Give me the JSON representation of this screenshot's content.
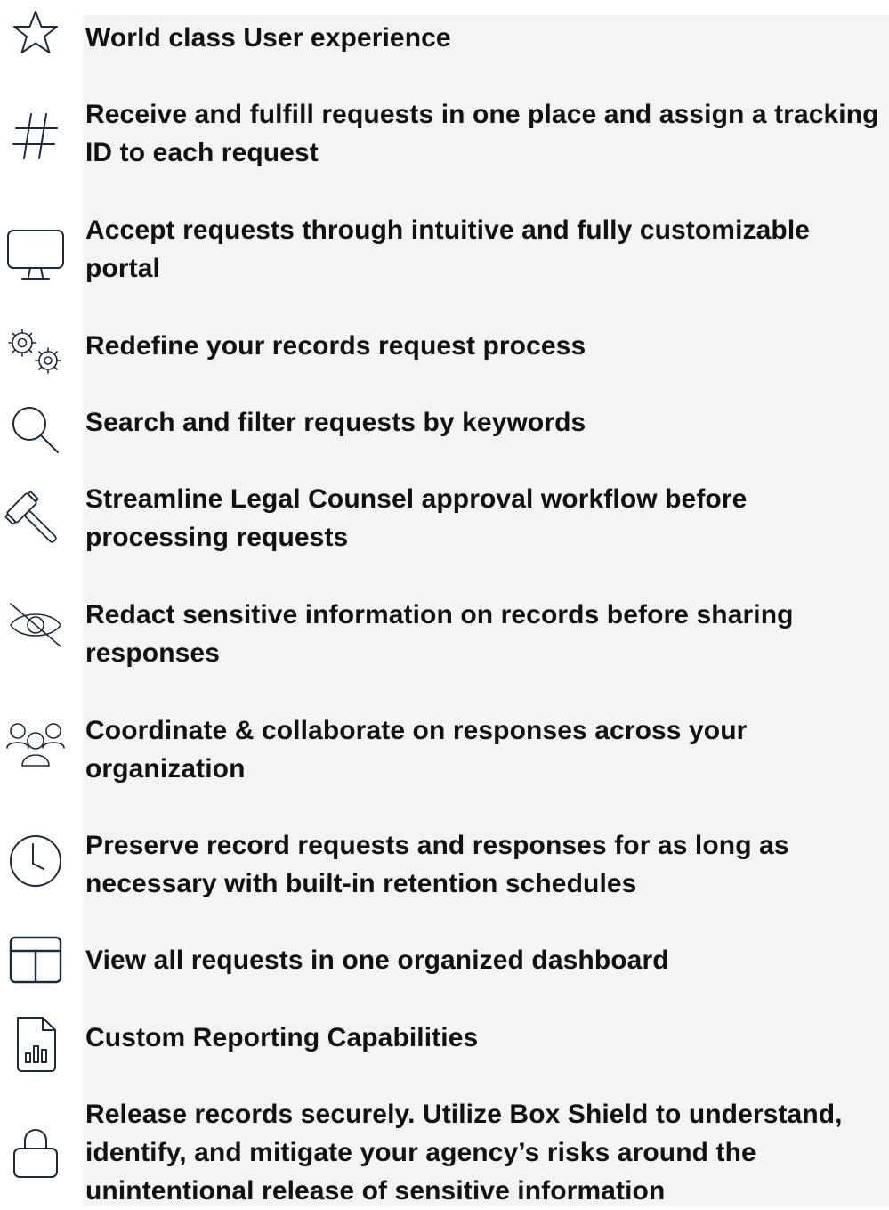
{
  "features": [
    {
      "icon": "star-icon",
      "text": "World class User experience"
    },
    {
      "icon": "hashtag-icon",
      "text": "Receive and fulfill requests in one place and assign a tracking ID to each request"
    },
    {
      "icon": "monitor-icon",
      "text": "Accept requests through intuitive and fully customizable portal"
    },
    {
      "icon": "gears-icon",
      "text": "Redefine your records request process"
    },
    {
      "icon": "search-icon",
      "text": "Search and filter requests by keywords"
    },
    {
      "icon": "gavel-icon",
      "text": "Streamline Legal Counsel approval workflow before processing requests"
    },
    {
      "icon": "eye-slash-icon",
      "text": "Redact sensitive information on records before sharing responses"
    },
    {
      "icon": "users-icon",
      "text": "Coordinate & collaborate on responses across your organization"
    },
    {
      "icon": "clock-icon",
      "text": "Preserve record requests and responses for as long as necessary with built-in retention schedules"
    },
    {
      "icon": "layout-icon",
      "text": "View all requests in one organized dashboard"
    },
    {
      "icon": "report-file-icon",
      "text": "Custom Reporting Capabilities"
    },
    {
      "icon": "lock-icon",
      "text": "Release records securely. Utilize Box Shield to understand, identify, and mitigate your agency’s risks around the unintentional release of sensitive information"
    }
  ]
}
